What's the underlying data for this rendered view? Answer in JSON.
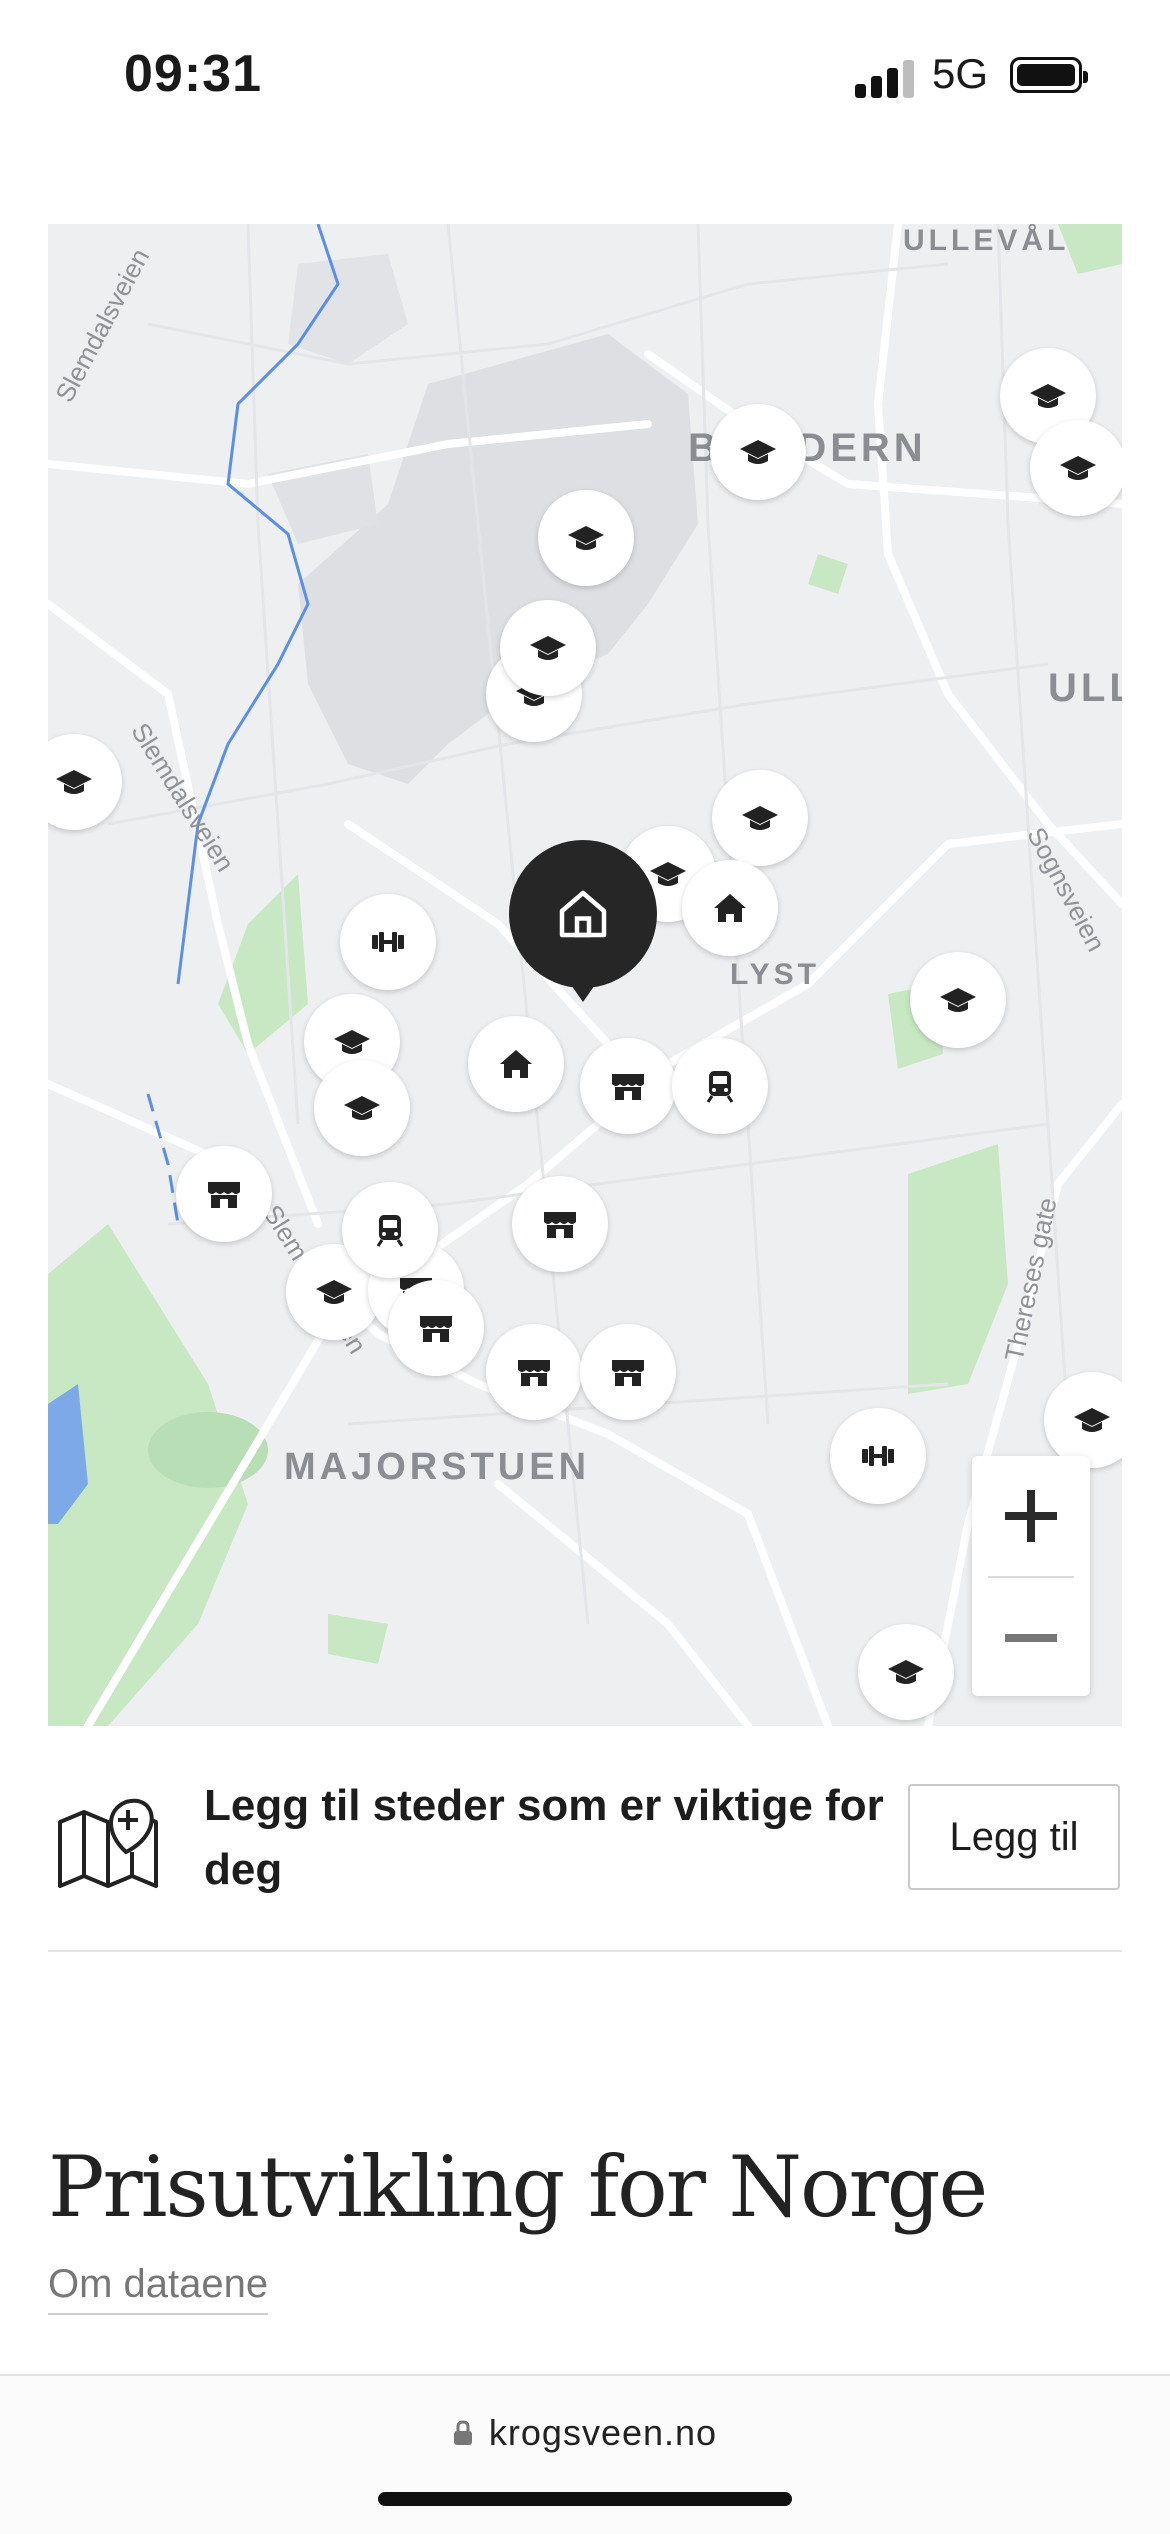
{
  "status_bar": {
    "time": "09:31",
    "network": "5G"
  },
  "map": {
    "labels": {
      "ulleval": "ULLEVÅL",
      "blindern": "BLINDERN",
      "ull": "ULL",
      "lyst": "LYST",
      "majorstuen": "MAJORSTUEN"
    },
    "streets": {
      "slemdalsveien_top": "Slemdalsveien",
      "slemdalsveien_mid": "Slemdalsveien",
      "slemdalsveien_low": "Slemdalsveien",
      "sognsveien": "Sognsveien",
      "thereses_gate": "Thereses gate"
    },
    "zoom_in_icon": "plus-icon",
    "zoom_out_icon": "minus-icon",
    "home_icon": "home-icon"
  },
  "add_places": {
    "icon": "map-pin-plus-icon",
    "text": "Legg til steder som er viktige for deg",
    "button_label": "Legg til"
  },
  "section": {
    "title": "Prisutvikling for Norge",
    "data_link": "Om dataene"
  },
  "browser": {
    "url": "krogsveen.no",
    "lock_icon": "lock-icon"
  }
}
